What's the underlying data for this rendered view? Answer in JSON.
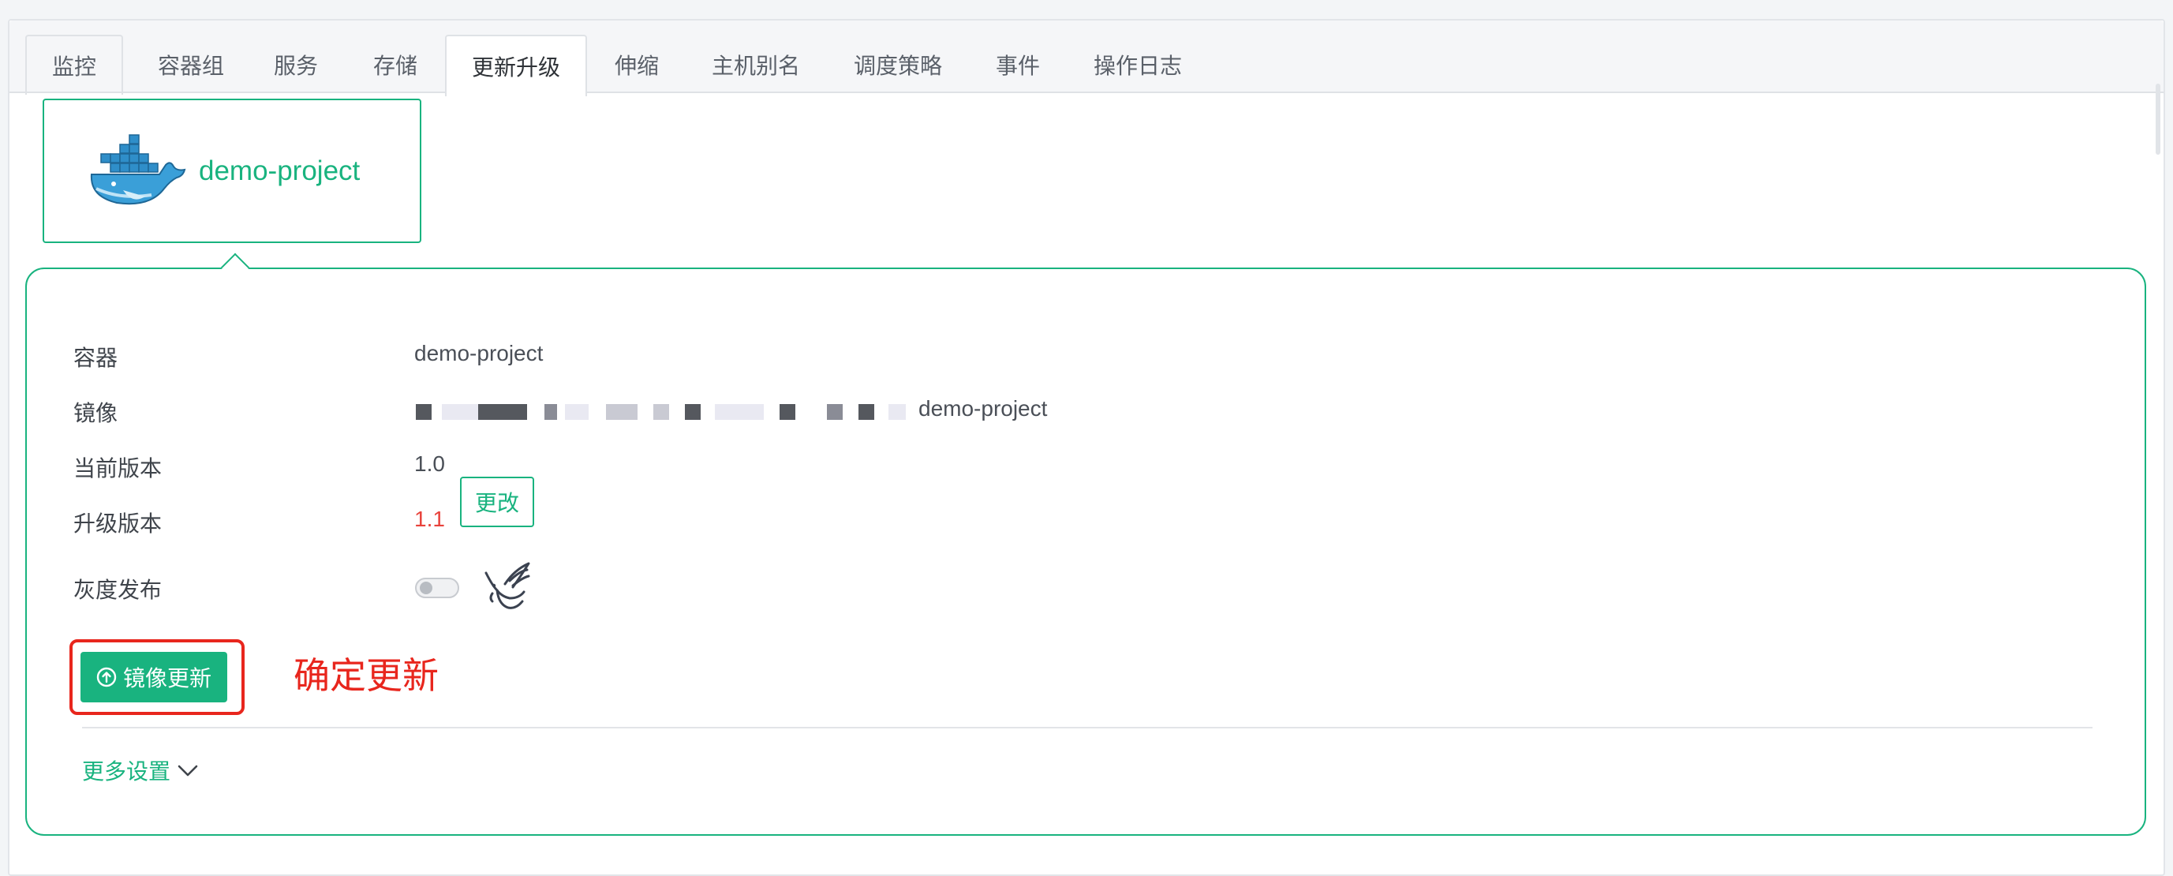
{
  "tabs": [
    {
      "label": "监控"
    },
    {
      "label": "容器组"
    },
    {
      "label": "服务"
    },
    {
      "label": "存储"
    },
    {
      "label": "更新升级",
      "active": true
    },
    {
      "label": "伸缩"
    },
    {
      "label": "主机别名"
    },
    {
      "label": "调度策略"
    },
    {
      "label": "事件"
    },
    {
      "label": "操作日志"
    }
  ],
  "project_card": {
    "name": "demo-project",
    "icon": "docker-whale-icon"
  },
  "details": {
    "container_label": "容器",
    "container_value": "demo-project",
    "image_label": "镜像",
    "image_value_suffix": "demo-project",
    "current_version_label": "当前版本",
    "current_version_value": "1.0",
    "upgrade_version_label": "升级版本",
    "upgrade_version_value": "1.1",
    "change_button": "更改",
    "gray_release_label": "灰度发布",
    "gray_release_enabled": false,
    "gray_release_icon": "bird-icon"
  },
  "actions": {
    "image_update_button": "镜像更新",
    "image_update_icon": "upload-circle-icon",
    "annotation": "确定更新",
    "more_settings": "更多设置"
  },
  "colors": {
    "accent": "#19b37f",
    "warning": "#e8423b",
    "annotation": "#e8261d"
  }
}
